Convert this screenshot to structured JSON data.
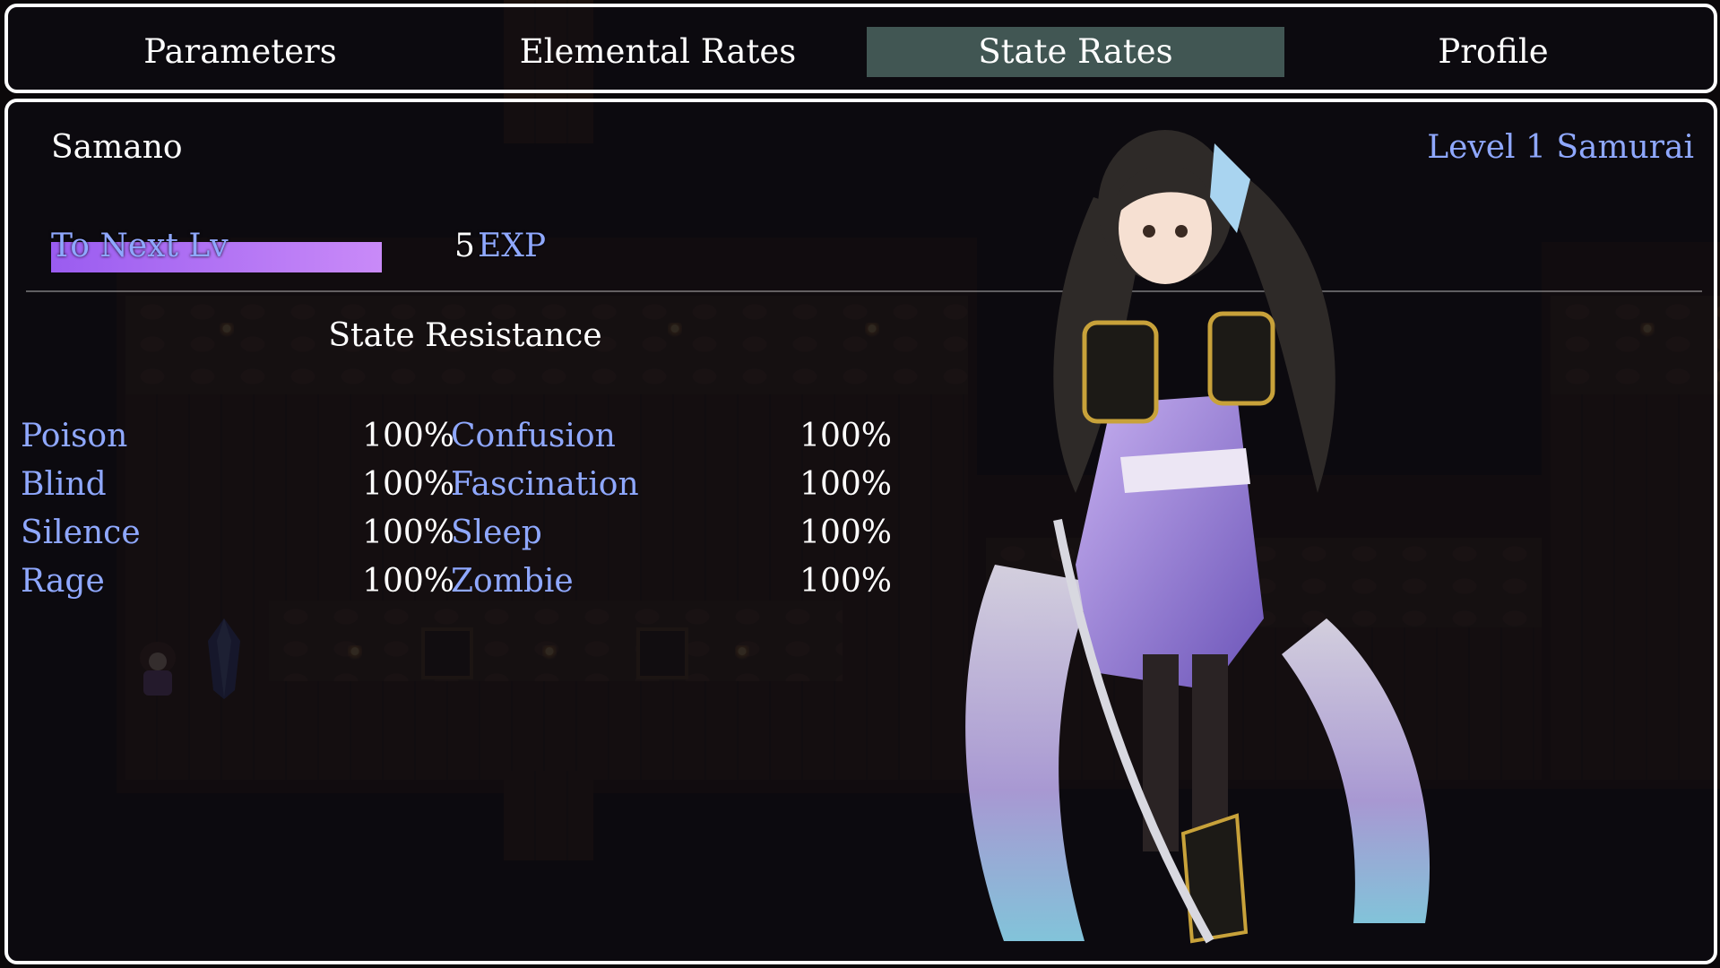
{
  "tabs": [
    {
      "label": "Parameters",
      "selected": false
    },
    {
      "label": "Elemental Rates",
      "selected": false
    },
    {
      "label": "State Rates",
      "selected": true
    },
    {
      "label": "Profile",
      "selected": false
    }
  ],
  "actor": {
    "name": "Samano",
    "level_class": "Level 1 Samurai",
    "exp_label": "To Next Lv",
    "exp_value": "5",
    "exp_unit": "EXP",
    "exp_progress": 0.82
  },
  "state_resistance": {
    "title": "State Resistance",
    "left_column": [
      {
        "name": "Poison",
        "value": "100%"
      },
      {
        "name": "Blind",
        "value": "100%"
      },
      {
        "name": "Silence",
        "value": "100%"
      },
      {
        "name": "Rage",
        "value": "100%"
      }
    ],
    "right_column": [
      {
        "name": "Confusion",
        "value": "100%"
      },
      {
        "name": "Fascination",
        "value": "100%"
      },
      {
        "name": "Sleep",
        "value": "100%"
      },
      {
        "name": "Zombie",
        "value": "100%"
      }
    ]
  },
  "colors": {
    "system_blue": "#8fa8ff",
    "gauge_start": "#9a5cf0",
    "gauge_end": "#c98af8",
    "tab_highlight": "#6e968c"
  },
  "icons": [
    "samurai-portrait",
    "map-character-sprite",
    "save-crystal"
  ]
}
